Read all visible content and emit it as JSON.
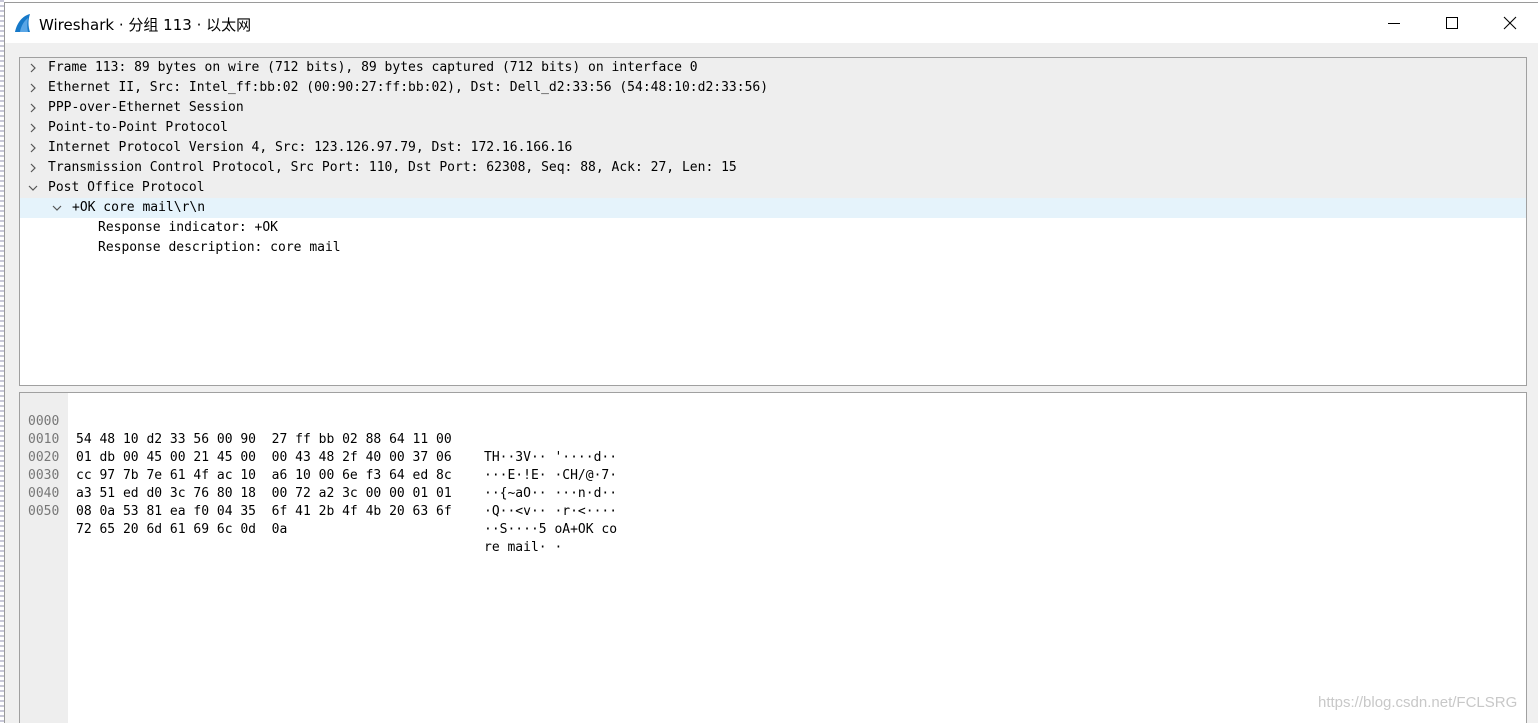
{
  "window": {
    "title": "Wireshark · 分组 113 · 以太网"
  },
  "packet_details": {
    "rows": [
      {
        "text": "Frame 113: 89 bytes on wire (712 bits), 89 bytes captured (712 bits) on interface 0",
        "expanded": false,
        "level": 0
      },
      {
        "text": "Ethernet II, Src: Intel_ff:bb:02 (00:90:27:ff:bb:02), Dst: Dell_d2:33:56 (54:48:10:d2:33:56)",
        "expanded": false,
        "level": 0
      },
      {
        "text": "PPP-over-Ethernet Session",
        "expanded": false,
        "level": 0
      },
      {
        "text": "Point-to-Point Protocol",
        "expanded": false,
        "level": 0
      },
      {
        "text": "Internet Protocol Version 4, Src: 123.126.97.79, Dst: 172.16.166.16",
        "expanded": false,
        "level": 0
      },
      {
        "text": "Transmission Control Protocol, Src Port: 110, Dst Port: 62308, Seq: 88, Ack: 27, Len: 15",
        "expanded": false,
        "level": 0
      },
      {
        "text": "Post Office Protocol",
        "expanded": true,
        "level": 0
      },
      {
        "text": "+OK core mail\\r\\n",
        "expanded": true,
        "level": 1,
        "selected": true
      },
      {
        "text": "Response indicator: +OK",
        "level": 2
      },
      {
        "text": "Response description: core mail",
        "level": 2
      }
    ]
  },
  "packet_bytes": {
    "rows": [
      {
        "offset": "0000",
        "hex": "54 48 10 d2 33 56 00 90  27 ff bb 02 88 64 11 00",
        "ascii": "TH··3V·· '····d··"
      },
      {
        "offset": "0010",
        "hex": "01 db 00 45 00 21 45 00  00 43 48 2f 40 00 37 06",
        "ascii": "···E·!E· ·CH/@·7·"
      },
      {
        "offset": "0020",
        "hex": "cc 97 7b 7e 61 4f ac 10  a6 10 00 6e f3 64 ed 8c",
        "ascii": "··{~aO·· ···n·d··"
      },
      {
        "offset": "0030",
        "hex": "a3 51 ed d0 3c 76 80 18  00 72 a2 3c 00 00 01 01",
        "ascii": "·Q··<v·· ·r·<····"
      },
      {
        "offset": "0040",
        "hex": "08 0a 53 81 ea f0 04 35  6f 41 2b 4f 4b 20 63 6f",
        "ascii": "··S····5 oA+OK co"
      },
      {
        "offset": "0050",
        "hex": "72 65 20 6d 61 69 6c 0d  0a",
        "ascii": "re mail· ·"
      }
    ]
  },
  "watermark": "https://blog.csdn.net/FCLSRG",
  "colors": {
    "selected_row": "#e5f3fb",
    "shaded_row": "#eeeeee",
    "offset_text": "#777777"
  }
}
